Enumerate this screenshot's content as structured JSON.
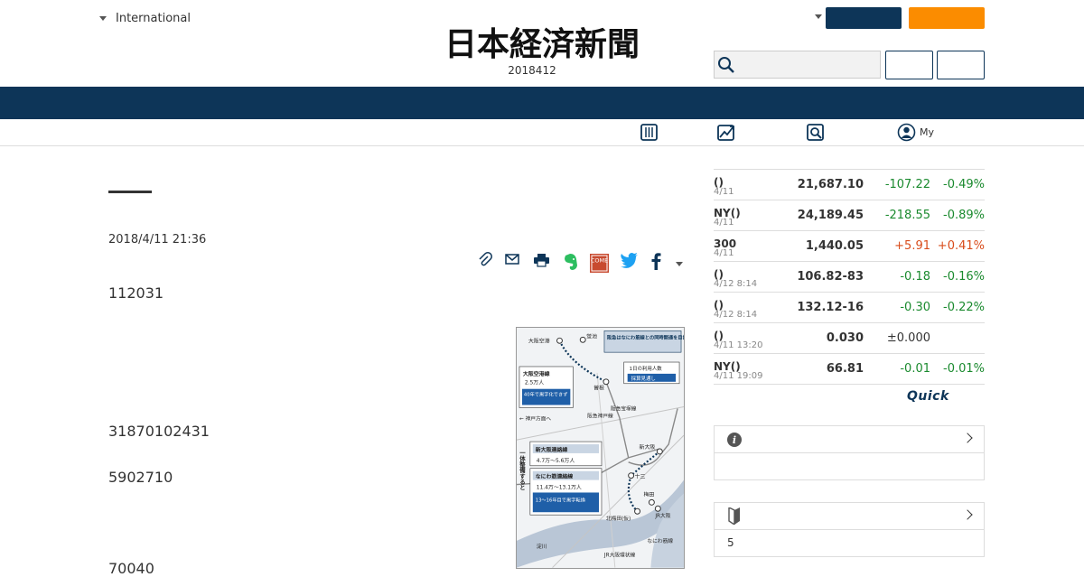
{
  "header": {
    "region_label": "International",
    "logo_text": "日本経済新聞",
    "date_line": "2018412",
    "search_placeholder": "",
    "subnav_my": "My"
  },
  "colors": {
    "navy": "#0d3558",
    "orange": "#fb8c00",
    "down": "#1a8a2e",
    "up": "#d94c1b"
  },
  "icons": [
    "chevron-down-icon",
    "search-icon",
    "newspaper-icon",
    "chart-icon",
    "magnifier-icon",
    "user-icon",
    "clip-icon",
    "mail-icon",
    "print-icon",
    "evernote-icon",
    "come-icon",
    "twitter-icon",
    "facebook-icon",
    "info-icon",
    "beginner-icon"
  ],
  "article": {
    "date": "2018/4/11 21:36",
    "paragraphs": [
      "112031",
      "31870102431",
      "5902710",
      "70040"
    ]
  },
  "share": {
    "come_label": "COME"
  },
  "map": {
    "labels": {
      "osaka_airport": "大阪空港",
      "hotarugaike": "蛍池",
      "callout_title": "阪急はなにわ筋線との同時開通を目指す",
      "daily_users": "1日の利用人数",
      "profit_outlook": "採算見通し",
      "airport_line": "大阪空港線",
      "airport_line_users": "2.5万人",
      "airport_line_note": "40年で黒字化できず",
      "sone": "曽根",
      "kobe_dir": "← 神戸方面へ",
      "hankyu_kobe": "阪急神戸線",
      "hankyu_takarazuka": "阪急宝塚線",
      "shin_osaka": "新大阪",
      "shin_osaka_link": "新大阪連絡線",
      "shin_osaka_link_users": "4.7万〜5.6万人",
      "juso": "十三",
      "naniwa_link": "なにわ筋連絡線",
      "naniwa_link_users": "11.4万〜13.1万人",
      "naniwa_link_note": "13〜16年目で黒字転換",
      "umeda": "梅田",
      "kitaumeda": "北梅田(仮)",
      "jr_osaka": "JR大阪",
      "integrated": "一体整備すると",
      "yodogawa": "淀川",
      "jr_loop": "JR大阪環状線",
      "naniwa_line": "なにわ筋線"
    }
  },
  "market": {
    "rows": [
      {
        "name": "()",
        "time": "4/11",
        "value": "21,687.10",
        "change": "-107.22",
        "pct": "-0.49%",
        "dir": "neg"
      },
      {
        "name": "NY()",
        "time": "4/11",
        "value": "24,189.45",
        "change": "-218.55",
        "pct": "-0.89%",
        "dir": "neg"
      },
      {
        "name": "300",
        "time": "4/11",
        "value": "1,440.05",
        "change": "+5.91",
        "pct": "+0.41%",
        "dir": "pos"
      },
      {
        "name": "()",
        "time": "4/12 8:14",
        "value": "106.82-83",
        "change": "-0.18",
        "pct": "-0.16%",
        "dir": "neg"
      },
      {
        "name": "()",
        "time": "4/12 8:14",
        "value": "132.12-16",
        "change": "-0.30",
        "pct": "-0.22%",
        "dir": "neg"
      },
      {
        "name": "()",
        "time": "4/11 13:20",
        "value": "0.030",
        "change": "±0.000",
        "pct": "",
        "dir": "neu"
      },
      {
        "name": "NY()",
        "time": "4/11 19:09",
        "value": "66.81",
        "change": "-0.01",
        "pct": "-0.01%",
        "dir": "neg"
      }
    ],
    "quick_label": "Quick"
  },
  "beginner": {
    "count": "5"
  }
}
